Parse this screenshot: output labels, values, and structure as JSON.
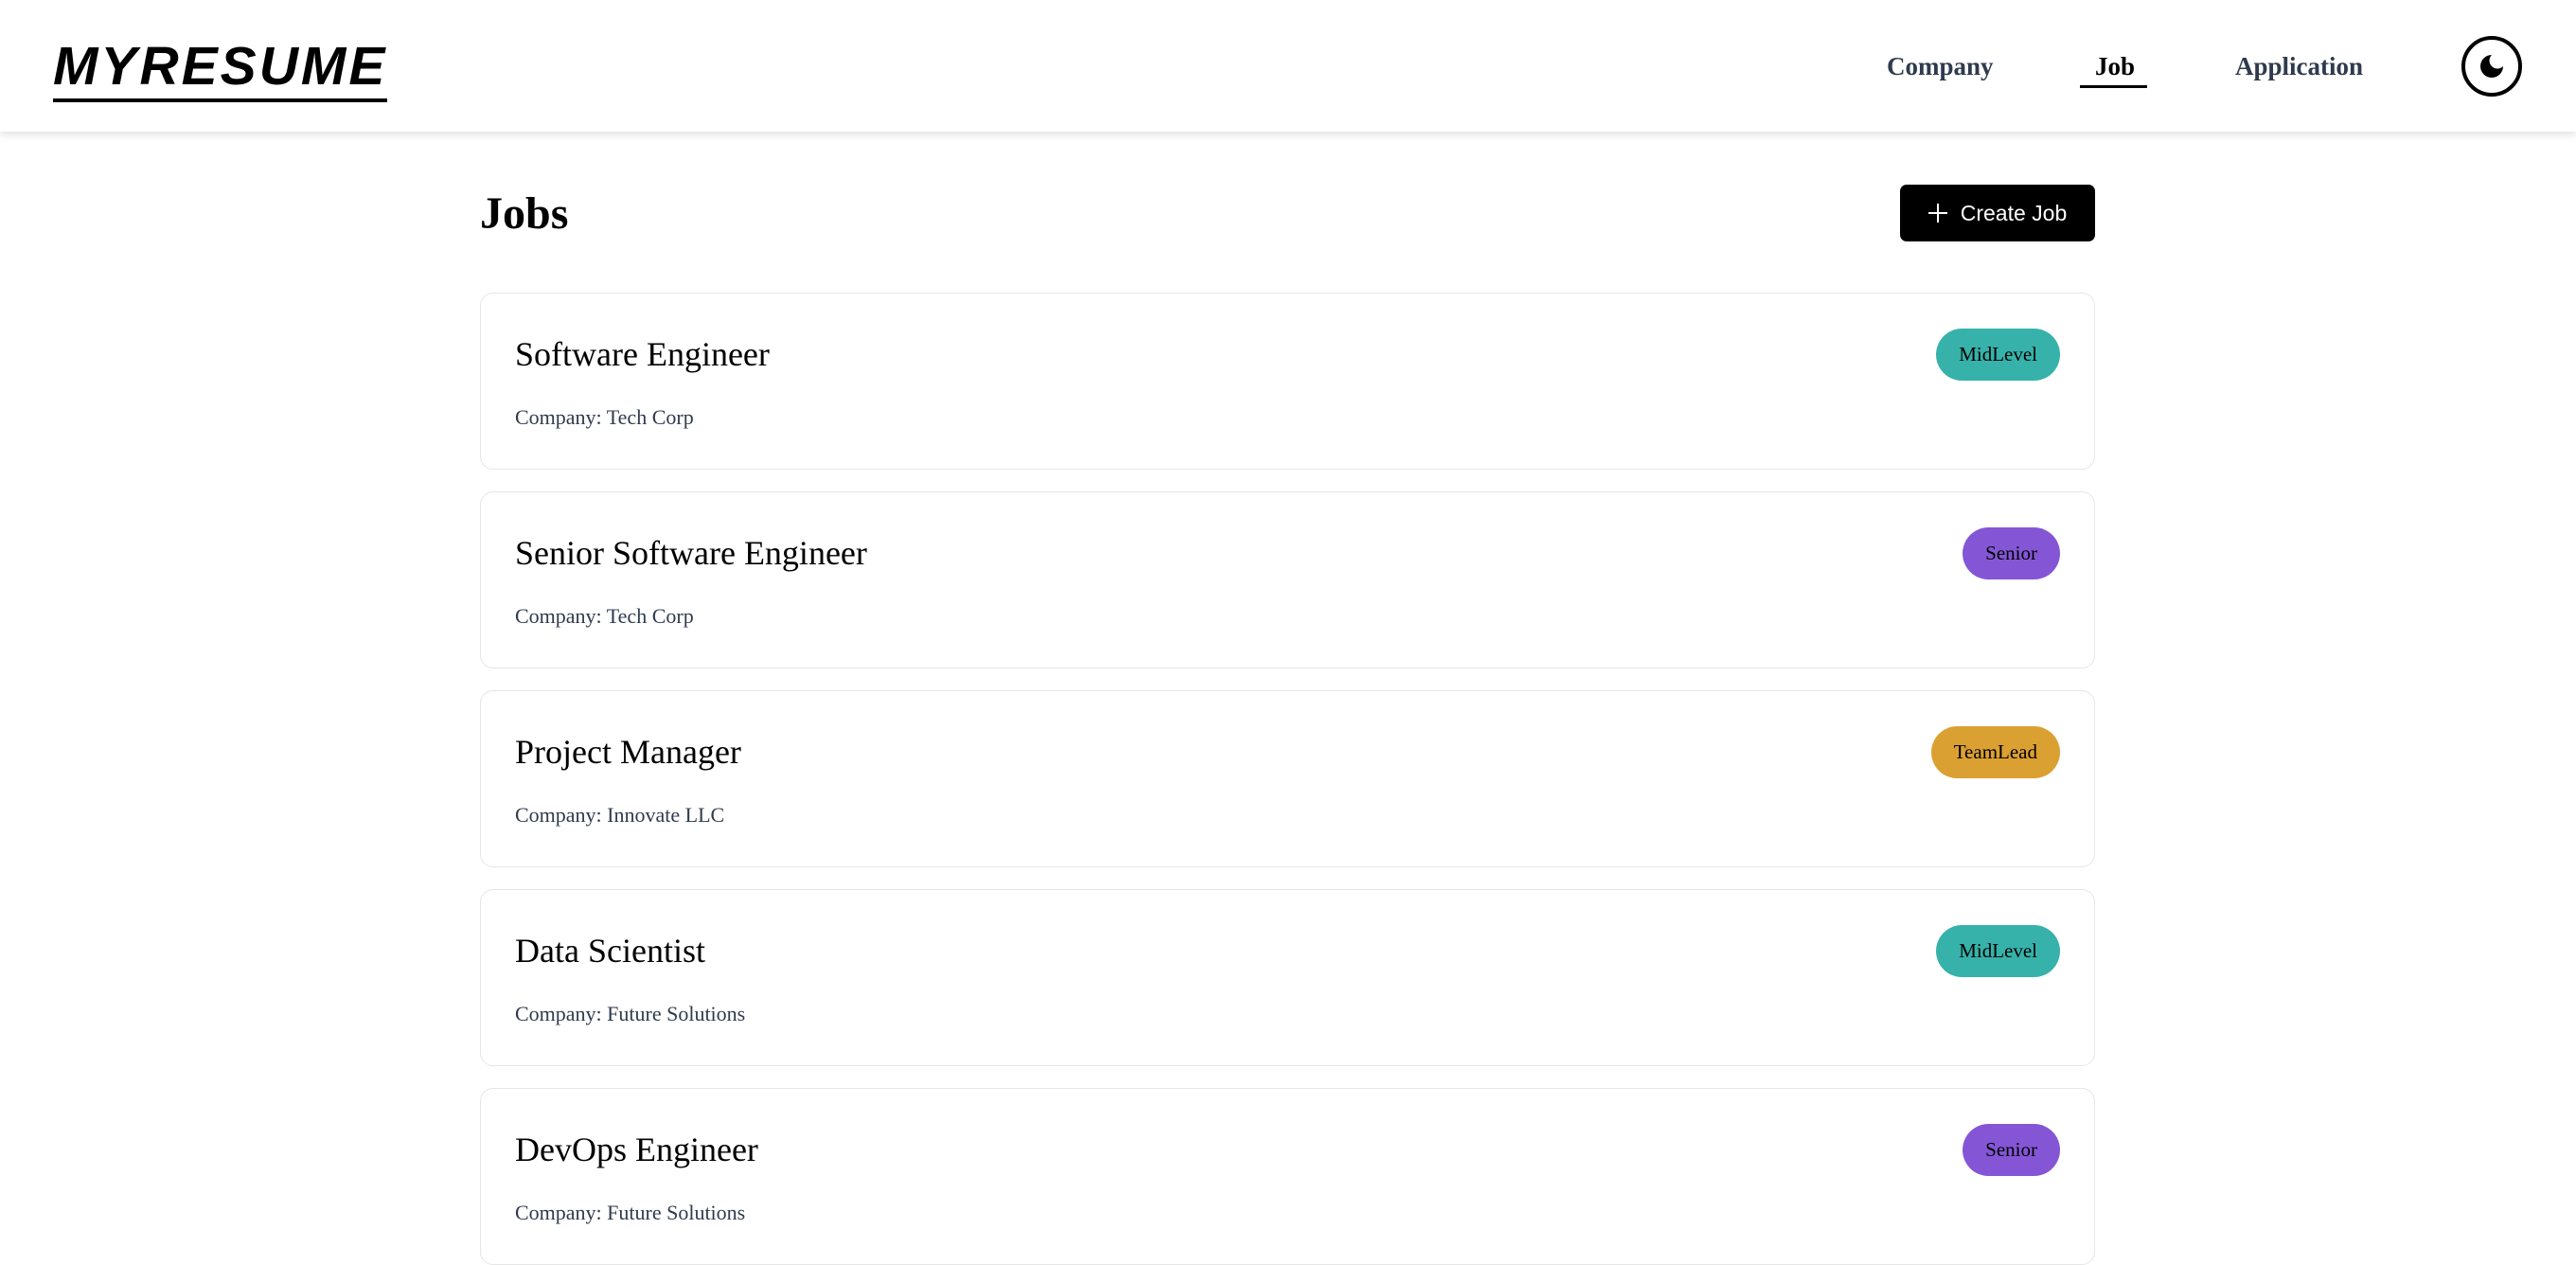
{
  "header": {
    "logo": "MYRESUME",
    "nav": {
      "company": "Company",
      "job": "Job",
      "application": "Application"
    },
    "active_nav": "Job",
    "theme_icon": "moon-icon"
  },
  "main": {
    "title": "Jobs",
    "create_button_label": "Create Job",
    "create_button_icon": "plus-icon",
    "jobs": [
      {
        "title": "Software Engineer",
        "company": "Company: Tech Corp",
        "level": "MidLevel",
        "level_color": "#36b2aa"
      },
      {
        "title": "Senior Software Engineer",
        "company": "Company: Tech Corp",
        "level": "Senior",
        "level_color": "#8456d6"
      },
      {
        "title": "Project Manager",
        "company": "Company: Innovate LLC",
        "level": "TeamLead",
        "level_color": "#dba032"
      },
      {
        "title": "Data Scientist",
        "company": "Company: Future Solutions",
        "level": "MidLevel",
        "level_color": "#36b2aa"
      },
      {
        "title": "DevOps Engineer",
        "company": "Company: Future Solutions",
        "level": "Senior",
        "level_color": "#8456d6"
      }
    ]
  }
}
